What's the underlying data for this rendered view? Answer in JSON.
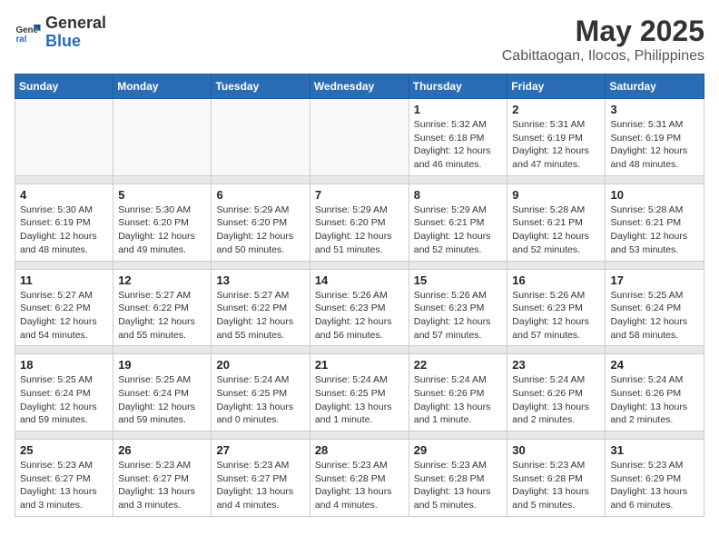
{
  "header": {
    "logo_general": "General",
    "logo_blue": "Blue",
    "title": "May 2025",
    "subtitle": "Cabittaogan, Ilocos, Philippines"
  },
  "weekdays": [
    "Sunday",
    "Monday",
    "Tuesday",
    "Wednesday",
    "Thursday",
    "Friday",
    "Saturday"
  ],
  "weeks": [
    [
      {
        "day": "",
        "info": ""
      },
      {
        "day": "",
        "info": ""
      },
      {
        "day": "",
        "info": ""
      },
      {
        "day": "",
        "info": ""
      },
      {
        "day": "1",
        "info": "Sunrise: 5:32 AM\nSunset: 6:18 PM\nDaylight: 12 hours\nand 46 minutes."
      },
      {
        "day": "2",
        "info": "Sunrise: 5:31 AM\nSunset: 6:19 PM\nDaylight: 12 hours\nand 47 minutes."
      },
      {
        "day": "3",
        "info": "Sunrise: 5:31 AM\nSunset: 6:19 PM\nDaylight: 12 hours\nand 48 minutes."
      }
    ],
    [
      {
        "day": "4",
        "info": "Sunrise: 5:30 AM\nSunset: 6:19 PM\nDaylight: 12 hours\nand 48 minutes."
      },
      {
        "day": "5",
        "info": "Sunrise: 5:30 AM\nSunset: 6:20 PM\nDaylight: 12 hours\nand 49 minutes."
      },
      {
        "day": "6",
        "info": "Sunrise: 5:29 AM\nSunset: 6:20 PM\nDaylight: 12 hours\nand 50 minutes."
      },
      {
        "day": "7",
        "info": "Sunrise: 5:29 AM\nSunset: 6:20 PM\nDaylight: 12 hours\nand 51 minutes."
      },
      {
        "day": "8",
        "info": "Sunrise: 5:29 AM\nSunset: 6:21 PM\nDaylight: 12 hours\nand 52 minutes."
      },
      {
        "day": "9",
        "info": "Sunrise: 5:28 AM\nSunset: 6:21 PM\nDaylight: 12 hours\nand 52 minutes."
      },
      {
        "day": "10",
        "info": "Sunrise: 5:28 AM\nSunset: 6:21 PM\nDaylight: 12 hours\nand 53 minutes."
      }
    ],
    [
      {
        "day": "11",
        "info": "Sunrise: 5:27 AM\nSunset: 6:22 PM\nDaylight: 12 hours\nand 54 minutes."
      },
      {
        "day": "12",
        "info": "Sunrise: 5:27 AM\nSunset: 6:22 PM\nDaylight: 12 hours\nand 55 minutes."
      },
      {
        "day": "13",
        "info": "Sunrise: 5:27 AM\nSunset: 6:22 PM\nDaylight: 12 hours\nand 55 minutes."
      },
      {
        "day": "14",
        "info": "Sunrise: 5:26 AM\nSunset: 6:23 PM\nDaylight: 12 hours\nand 56 minutes."
      },
      {
        "day": "15",
        "info": "Sunrise: 5:26 AM\nSunset: 6:23 PM\nDaylight: 12 hours\nand 57 minutes."
      },
      {
        "day": "16",
        "info": "Sunrise: 5:26 AM\nSunset: 6:23 PM\nDaylight: 12 hours\nand 57 minutes."
      },
      {
        "day": "17",
        "info": "Sunrise: 5:25 AM\nSunset: 6:24 PM\nDaylight: 12 hours\nand 58 minutes."
      }
    ],
    [
      {
        "day": "18",
        "info": "Sunrise: 5:25 AM\nSunset: 6:24 PM\nDaylight: 12 hours\nand 59 minutes."
      },
      {
        "day": "19",
        "info": "Sunrise: 5:25 AM\nSunset: 6:24 PM\nDaylight: 12 hours\nand 59 minutes."
      },
      {
        "day": "20",
        "info": "Sunrise: 5:24 AM\nSunset: 6:25 PM\nDaylight: 13 hours\nand 0 minutes."
      },
      {
        "day": "21",
        "info": "Sunrise: 5:24 AM\nSunset: 6:25 PM\nDaylight: 13 hours\nand 1 minute."
      },
      {
        "day": "22",
        "info": "Sunrise: 5:24 AM\nSunset: 6:26 PM\nDaylight: 13 hours\nand 1 minute."
      },
      {
        "day": "23",
        "info": "Sunrise: 5:24 AM\nSunset: 6:26 PM\nDaylight: 13 hours\nand 2 minutes."
      },
      {
        "day": "24",
        "info": "Sunrise: 5:24 AM\nSunset: 6:26 PM\nDaylight: 13 hours\nand 2 minutes."
      }
    ],
    [
      {
        "day": "25",
        "info": "Sunrise: 5:23 AM\nSunset: 6:27 PM\nDaylight: 13 hours\nand 3 minutes."
      },
      {
        "day": "26",
        "info": "Sunrise: 5:23 AM\nSunset: 6:27 PM\nDaylight: 13 hours\nand 3 minutes."
      },
      {
        "day": "27",
        "info": "Sunrise: 5:23 AM\nSunset: 6:27 PM\nDaylight: 13 hours\nand 4 minutes."
      },
      {
        "day": "28",
        "info": "Sunrise: 5:23 AM\nSunset: 6:28 PM\nDaylight: 13 hours\nand 4 minutes."
      },
      {
        "day": "29",
        "info": "Sunrise: 5:23 AM\nSunset: 6:28 PM\nDaylight: 13 hours\nand 5 minutes."
      },
      {
        "day": "30",
        "info": "Sunrise: 5:23 AM\nSunset: 6:28 PM\nDaylight: 13 hours\nand 5 minutes."
      },
      {
        "day": "31",
        "info": "Sunrise: 5:23 AM\nSunset: 6:29 PM\nDaylight: 13 hours\nand 6 minutes."
      }
    ]
  ]
}
